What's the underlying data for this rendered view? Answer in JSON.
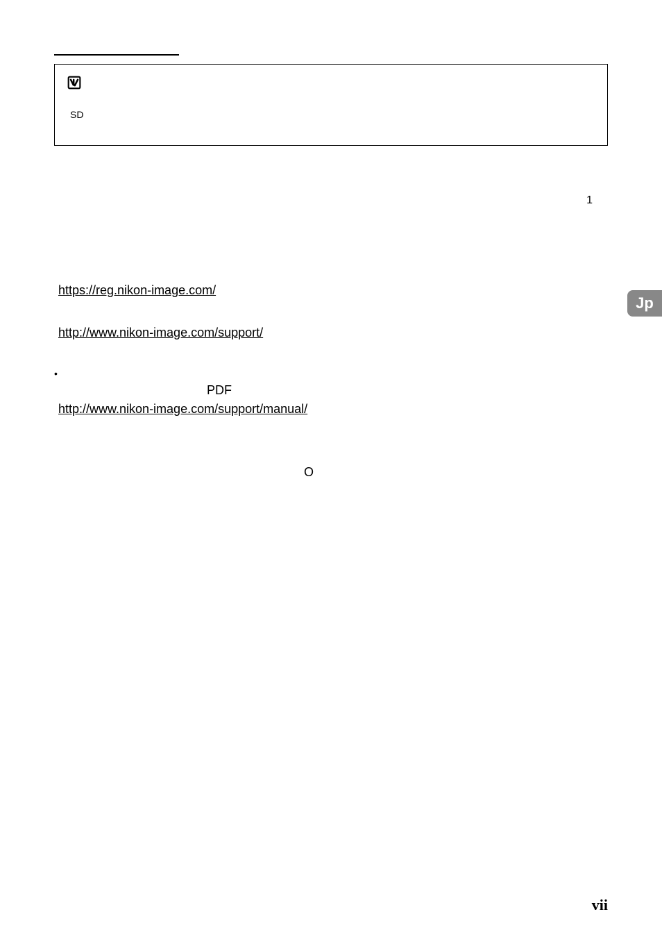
{
  "topLabel": "",
  "noticeBox": {
    "bodyPrefix": "",
    "sdText": "SD",
    "bodySuffix": ""
  },
  "refNumber": "1",
  "langBadge": "Jp",
  "links": {
    "registration": "https://reg.nikon-image.com/",
    "support": "http://www.nikon-image.com/support/",
    "manual": "http://www.nikon-image.com/support/manual/"
  },
  "bulletDot": "•",
  "pdfText": "PDF",
  "oText": "O",
  "pageNumber": "vii"
}
